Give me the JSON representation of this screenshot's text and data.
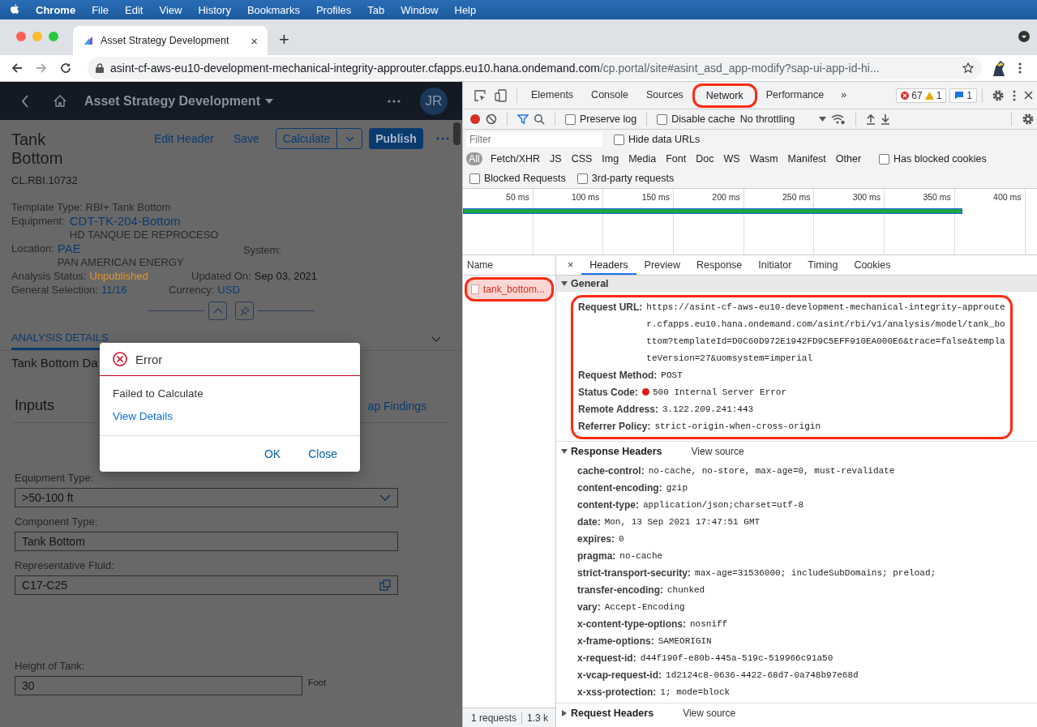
{
  "menubar": {
    "app": "Chrome",
    "items": [
      "File",
      "Edit",
      "View",
      "History",
      "Bookmarks",
      "Profiles",
      "Tab",
      "Window",
      "Help"
    ]
  },
  "browser": {
    "tab_title": "Asset Strategy Development",
    "tab_close": "×",
    "new_tab": "+",
    "url_host": "asint-cf-aws-eu10-development-mechanical-integrity-approuter.cfapps.eu10.hana.ondemand.com",
    "url_path": "/cp.portal/site#asint_asd_app-modify?sap-ui-app-id-hi..."
  },
  "app": {
    "shell_title": "Asset Strategy Development",
    "avatar": "JR",
    "title": "Tank Bottom",
    "object_id": "CL.RBI.10732",
    "actions": [
      {
        "kind": "link",
        "label": "Edit Header"
      },
      {
        "kind": "link",
        "label": "Save"
      },
      {
        "kind": "split",
        "label": "Calculate"
      },
      {
        "kind": "primary",
        "label": "Publish"
      }
    ],
    "template_type": "Template Type: RBI+ Tank Bottom",
    "equipment": {
      "label": "Equipment:",
      "value": "CDT-TK-204-Bottom",
      "description": "HD TANQUE DE REPROCESO"
    },
    "location": {
      "label": "Location:",
      "value": "PAE",
      "description": "PAN AMERICAN ENERGY"
    },
    "system": {
      "label": "System:"
    },
    "analysis_status": {
      "label": "Analysis Status:",
      "value": "Unpublished"
    },
    "updated_on": {
      "label": "Updated On:",
      "value": "Sep 03, 2021"
    },
    "general_selection": {
      "label": "General Selection:",
      "value": "11/16"
    },
    "currency": {
      "label": "Currency:",
      "value": "USD"
    },
    "section_tabs": [
      {
        "label": "ANALYSIS DETAILS",
        "selected": true
      }
    ],
    "subsection_title": "Tank Bottom Da",
    "inputs_title": "Inputs",
    "findings_link": "ap Findings",
    "fields": [
      {
        "kind": "select",
        "label": "Equipment Type:",
        "value": ">50-100 ft"
      },
      {
        "kind": "text",
        "label": "Component Type:",
        "value": "Tank Bottom"
      },
      {
        "kind": "valuehelp",
        "label": "Representative Fluid:",
        "value": "C17-C25"
      },
      {
        "kind": "unit",
        "label": "Height of Tank:",
        "value": "30",
        "unit": "Foot"
      }
    ]
  },
  "dialog": {
    "title": "Error",
    "message": "Failed to Calculate",
    "link": "View Details",
    "buttons": [
      "OK",
      "Close"
    ]
  },
  "devtools": {
    "tabs": [
      {
        "label": "Elements",
        "selected": false,
        "highlighted": false
      },
      {
        "label": "Console",
        "selected": false,
        "highlighted": false
      },
      {
        "label": "Sources",
        "selected": false,
        "highlighted": false
      },
      {
        "label": "Network",
        "selected": true,
        "highlighted": true
      },
      {
        "label": "Performance",
        "selected": false,
        "highlighted": false
      }
    ],
    "more": "»",
    "errors": "67",
    "warnings": "1",
    "messages": "1",
    "preserve_log": {
      "label": "Preserve log",
      "checked": false
    },
    "disable_cache": {
      "label": "Disable cache",
      "checked": false
    },
    "throttling": "No throttling",
    "filter_placeholder": "Filter",
    "hide_data_urls": {
      "label": "Hide data URLs",
      "checked": false
    },
    "types": [
      {
        "label": "All",
        "selected": true
      },
      {
        "label": "Fetch/XHR",
        "selected": false
      },
      {
        "label": "JS",
        "selected": false
      },
      {
        "label": "CSS",
        "selected": false
      },
      {
        "label": "Img",
        "selected": false
      },
      {
        "label": "Media",
        "selected": false
      },
      {
        "label": "Font",
        "selected": false
      },
      {
        "label": "Doc",
        "selected": false
      },
      {
        "label": "WS",
        "selected": false
      },
      {
        "label": "Wasm",
        "selected": false
      },
      {
        "label": "Manifest",
        "selected": false
      },
      {
        "label": "Other",
        "selected": false
      }
    ],
    "has_blocked_cookies": {
      "label": "Has blocked cookies",
      "checked": false
    },
    "blocked_requests": {
      "label": "Blocked Requests",
      "checked": false
    },
    "third_party": {
      "label": "3rd-party requests",
      "checked": false
    },
    "timeline_ticks": [
      "50 ms",
      "100 ms",
      "150 ms",
      "200 ms",
      "250 ms",
      "300 ms",
      "350 ms",
      "400 ms"
    ],
    "name_header": "Name",
    "requests": [
      {
        "name": "tank_bottom...",
        "selected": true,
        "failed": true,
        "highlighted": true
      }
    ],
    "footer": [
      "1 requests",
      "1.3 k"
    ],
    "detail_close": "×",
    "detail_tabs": [
      {
        "label": "Headers",
        "selected": true
      },
      {
        "label": "Preview",
        "selected": false
      },
      {
        "label": "Response",
        "selected": false
      },
      {
        "label": "Initiator",
        "selected": false
      },
      {
        "label": "Timing",
        "selected": false
      },
      {
        "label": "Cookies",
        "selected": false
      }
    ],
    "general": {
      "title": "General",
      "expanded": true,
      "highlighted": true,
      "rows": [
        {
          "key": "Request URL:",
          "value": "https://asint-cf-aws-eu10-development-mechanical-integrity-approuter.cfapps.eu10.hana.ondemand.com/asint/rbi/v1/analysis/model/tank_bottom?templateId=D0C60D972E1942FD9C5EFF910EA000E6&trace=false&templateVersion=27&uomsystem=imperial",
          "status_dot": false
        },
        {
          "key": "Request Method:",
          "value": "POST",
          "status_dot": false
        },
        {
          "key": "Status Code:",
          "value": "500 Internal Server Error",
          "status_dot": true
        },
        {
          "key": "Remote Address:",
          "value": "3.122.209.241:443",
          "status_dot": false
        },
        {
          "key": "Referrer Policy:",
          "value": "strict-origin-when-cross-origin",
          "status_dot": false
        }
      ]
    },
    "response_headers": {
      "title": "Response Headers",
      "expanded": true,
      "view_source": "View source",
      "rows": [
        {
          "key": "cache-control:",
          "value": "no-cache, no-store, max-age=0, must-revalidate"
        },
        {
          "key": "content-encoding:",
          "value": "gzip"
        },
        {
          "key": "content-type:",
          "value": "application/json;charset=utf-8"
        },
        {
          "key": "date:",
          "value": "Mon, 13 Sep 2021 17:47:51 GMT"
        },
        {
          "key": "expires:",
          "value": "0"
        },
        {
          "key": "pragma:",
          "value": "no-cache"
        },
        {
          "key": "strict-transport-security:",
          "value": "max-age=31536000; includeSubDomains; preload;"
        },
        {
          "key": "transfer-encoding:",
          "value": "chunked"
        },
        {
          "key": "vary:",
          "value": "Accept-Encoding"
        },
        {
          "key": "x-content-type-options:",
          "value": "nosniff"
        },
        {
          "key": "x-frame-options:",
          "value": "SAMEORIGIN"
        },
        {
          "key": "x-request-id:",
          "value": "d44f190f-e80b-445a-519c-519966c91a50"
        },
        {
          "key": "x-vcap-request-id:",
          "value": "1d2124c8-0636-4422-68d7-0a748b97e68d"
        },
        {
          "key": "x-xss-protection:",
          "value": "1; mode=block"
        }
      ]
    },
    "request_headers": {
      "title": "Request Headers",
      "expanded": false,
      "view_source": "View source"
    }
  }
}
